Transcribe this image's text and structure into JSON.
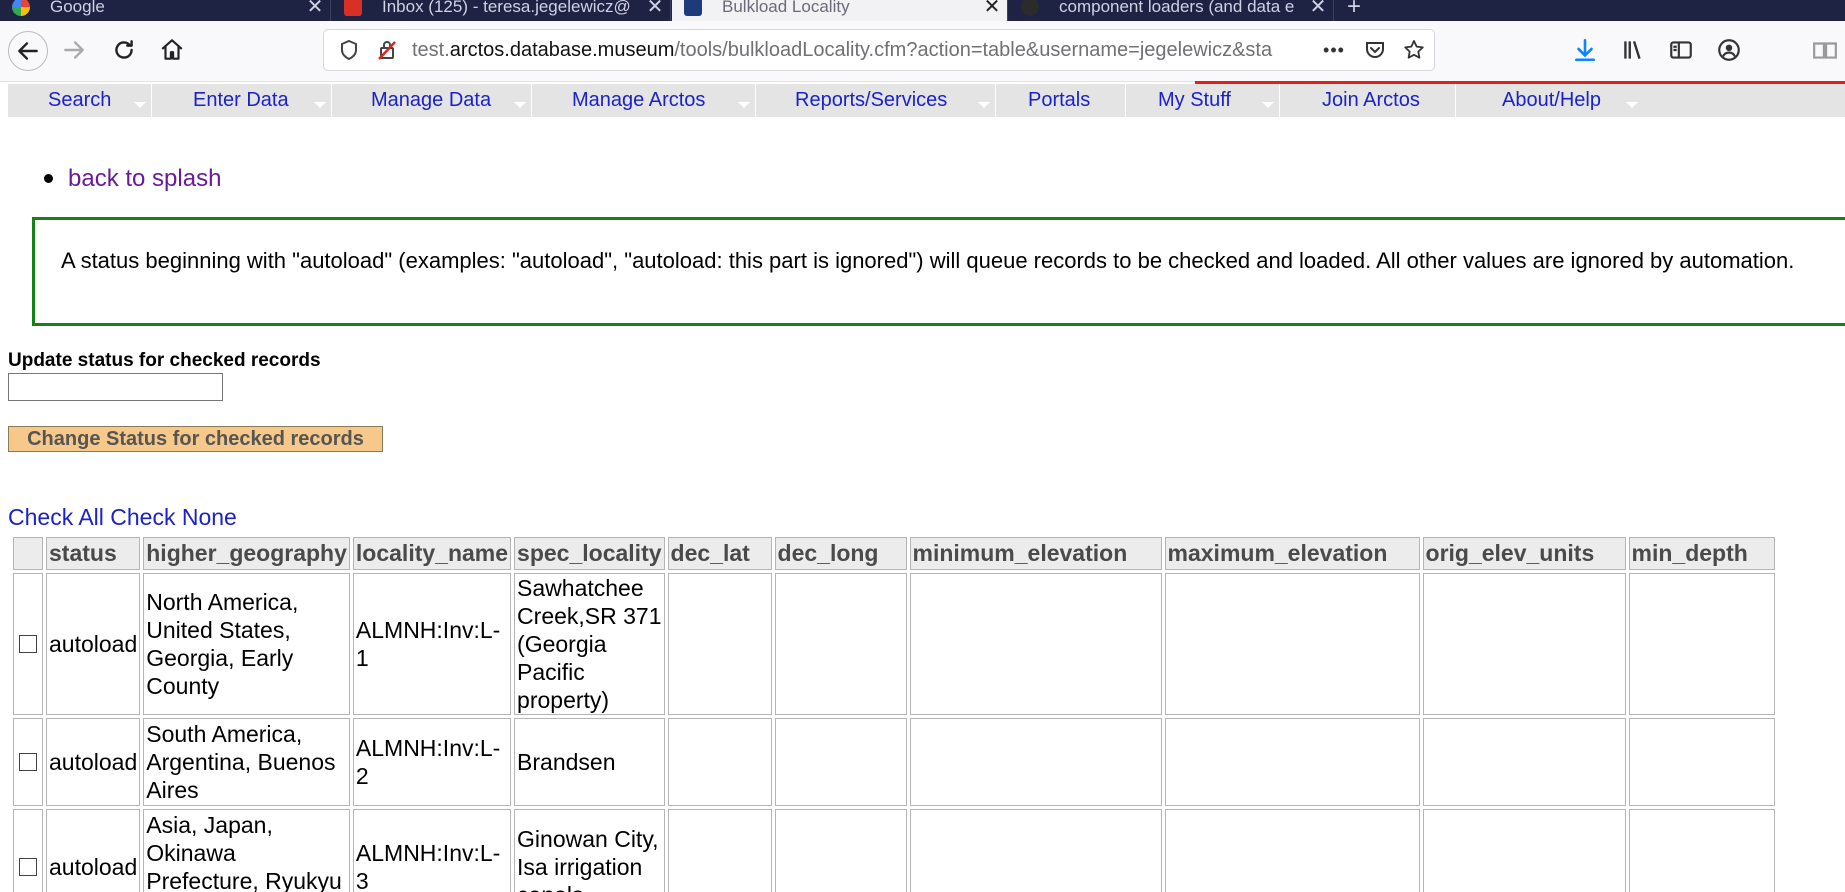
{
  "browser": {
    "tabs": [
      {
        "title": "Google",
        "active": false
      },
      {
        "title": "Inbox (125) - teresa.jegelewicz@",
        "active": false
      },
      {
        "title": "Bulkload Locality",
        "active": true
      },
      {
        "title": "component loaders (and data e",
        "active": false
      }
    ],
    "new_tab_label": "+",
    "url_prefix": "test.",
    "url_domain": "arctos.database.museum",
    "url_rest": "/tools/bulkloadLocality.cfm?action=table&username=jegelewicz&sta",
    "url_more": "•••",
    "accent_color": "#e0201b"
  },
  "nav": {
    "items": [
      "Search",
      "Enter Data",
      "Manage Data",
      "Manage Arctos",
      "Reports/Services",
      "Portals",
      "My Stuff",
      "Join Arctos",
      "About/Help"
    ]
  },
  "page": {
    "back_link": "back to splash",
    "notice": "A status beginning with \"autoload\" (examples: \"autoload\", \"autoload: this part is ignored\") will queue records to be checked and loaded. All other values are ignored by automation.",
    "update_label": "Update status for checked records",
    "update_value": "",
    "change_button": "Change Status for checked records",
    "check_all": "Check All",
    "check_none": "Check None"
  },
  "table": {
    "headers": [
      "",
      "status",
      "higher_geography",
      "locality_name",
      "spec_locality",
      "dec_lat",
      "dec_long",
      "minimum_elevation",
      "maximum_elevation",
      "orig_elev_units",
      "min_depth"
    ],
    "rows": [
      {
        "status": "autoload",
        "higher_geography": "North America, United States, Georgia, Early County",
        "locality_name": "ALMNH:Inv:L-1",
        "spec_locality": "Sawhatchee Creek,SR 371 (Georgia Pacific property)",
        "dec_lat": "",
        "dec_long": "",
        "minimum_elevation": "",
        "maximum_elevation": "",
        "orig_elev_units": "",
        "min_depth": ""
      },
      {
        "status": "autoload",
        "higher_geography": "South America, Argentina, Buenos Aires",
        "locality_name": "ALMNH:Inv:L-2",
        "spec_locality": "Brandsen",
        "dec_lat": "",
        "dec_long": "",
        "minimum_elevation": "",
        "maximum_elevation": "",
        "orig_elev_units": "",
        "min_depth": ""
      },
      {
        "status": "autoload",
        "higher_geography": "Asia, Japan, Okinawa Prefecture, Ryukyu Islands, Okinawa",
        "locality_name": "ALMNH:Inv:L-3",
        "spec_locality": "Ginowan City, Isa irrigation canals",
        "dec_lat": "",
        "dec_long": "",
        "minimum_elevation": "",
        "maximum_elevation": "",
        "orig_elev_units": "",
        "min_depth": ""
      }
    ]
  }
}
